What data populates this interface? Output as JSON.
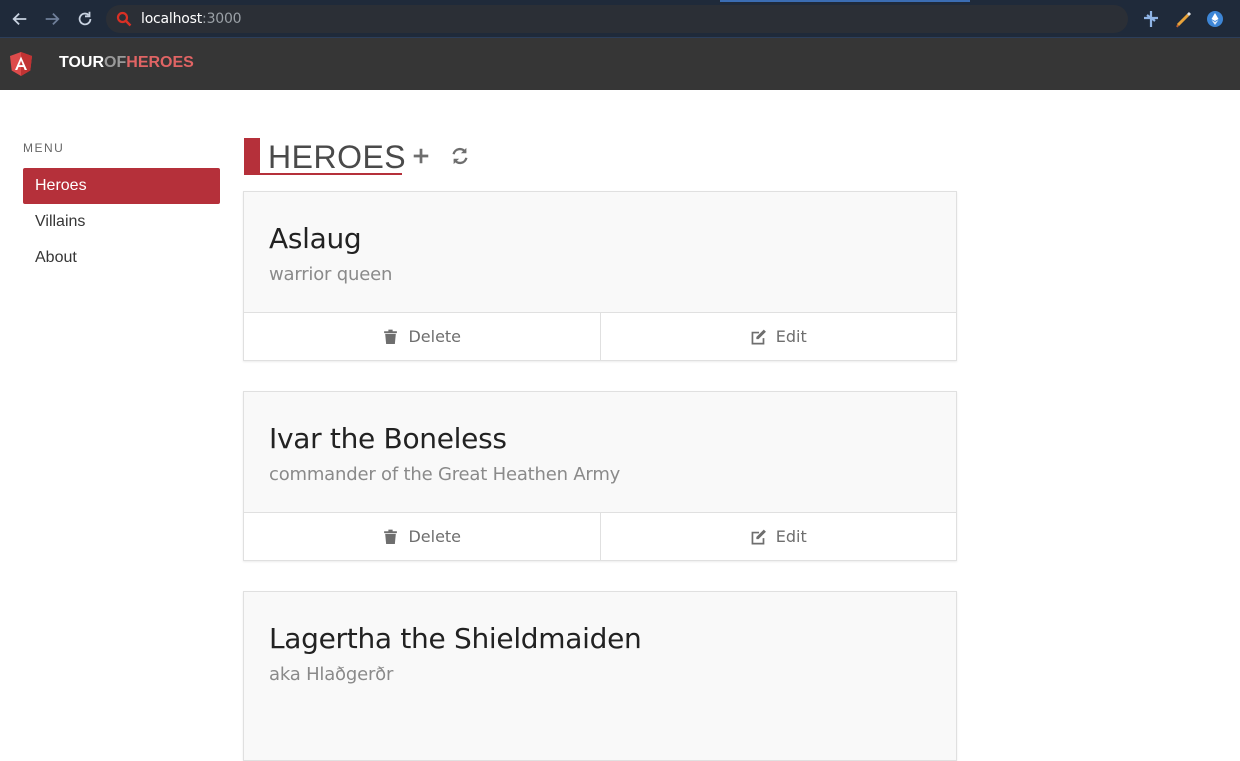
{
  "browser": {
    "url_host": "localhost",
    "url_port": ":3000",
    "icons": [
      "back-arrow-icon",
      "forward-arrow-icon",
      "reload-icon",
      "search-icon",
      "extension-icon",
      "pen-icon",
      "ethereum-icon"
    ]
  },
  "header": {
    "brand_part1": "TOUR",
    "brand_part2": "OF",
    "brand_part3": "HEROES",
    "logo_icon": "angular-logo-icon"
  },
  "sidebar": {
    "label": "MENU",
    "items": [
      {
        "label": "Heroes",
        "active": true
      },
      {
        "label": "Villains",
        "active": false
      },
      {
        "label": "About",
        "active": false
      }
    ]
  },
  "main": {
    "title": "HEROES",
    "add_icon": "plus-icon",
    "refresh_icon": "refresh-icon",
    "heroes": [
      {
        "name": "Aslaug",
        "description": "warrior queen"
      },
      {
        "name": "Ivar the Boneless",
        "description": "commander of the Great Heathen Army"
      },
      {
        "name": "Lagertha the Shieldmaiden",
        "description": "aka Hlaðgerðr"
      }
    ],
    "delete_label": "Delete",
    "edit_label": "Edit"
  },
  "colors": {
    "accent": "#b5303a",
    "header_bg": "#363636",
    "brand_heroes": "#e06464"
  }
}
